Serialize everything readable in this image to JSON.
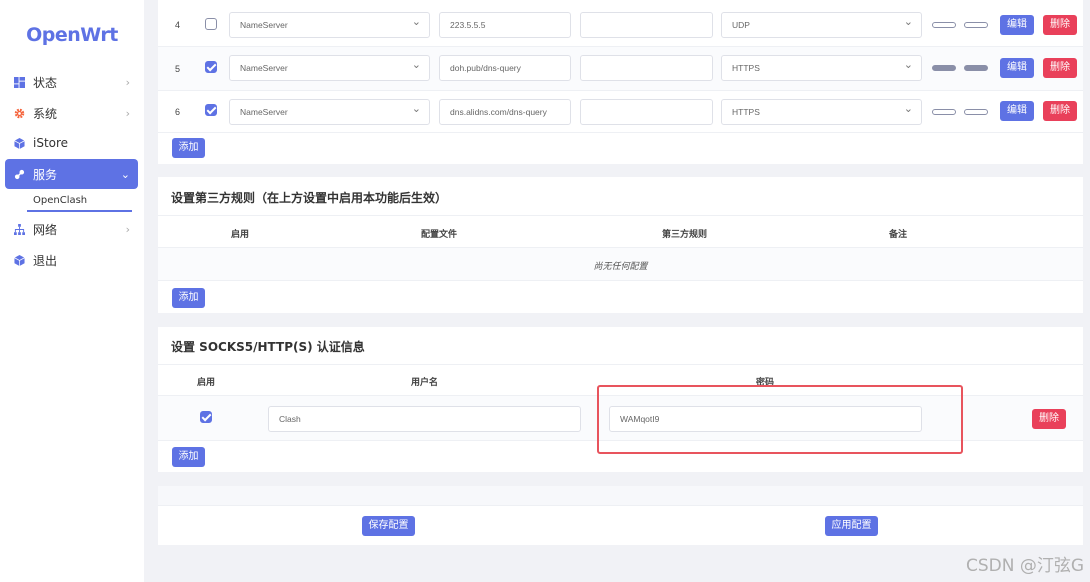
{
  "sidebar": {
    "logo": "OpenWrt",
    "items": [
      {
        "label": "状态",
        "icon": "dashboard-icon"
      },
      {
        "label": "系统",
        "icon": "gear-icon"
      },
      {
        "label": "iStore",
        "icon": "cube-icon"
      },
      {
        "label": "服务",
        "icon": "services-icon"
      },
      {
        "label": "网络",
        "icon": "network-icon"
      },
      {
        "label": "退出",
        "icon": "logout-icon"
      }
    ],
    "subitem": "OpenClash",
    "accent": "#5e72e4"
  },
  "dns_table": {
    "rows": [
      {
        "index": "4",
        "enabled": false,
        "type": "NameServer",
        "address": "223.5.5.5",
        "port": "",
        "protocol": "UDP",
        "edit": "编辑",
        "delete": "删除"
      },
      {
        "index": "5",
        "enabled": true,
        "type": "NameServer",
        "address": "doh.pub/dns-query",
        "port": "",
        "protocol": "HTTPS",
        "edit": "编辑",
        "delete": "删除"
      },
      {
        "index": "6",
        "enabled": true,
        "type": "NameServer",
        "address": "dns.alidns.com/dns-query",
        "port": "",
        "protocol": "HTTPS",
        "edit": "编辑",
        "delete": "删除"
      }
    ],
    "add_label": "添加"
  },
  "rules_section": {
    "title": "设置第三方规则（在上方设置中启用本功能后生效）",
    "headers": [
      "启用",
      "配置文件",
      "第三方规则",
      "备注"
    ],
    "empty_text": "尚无任何配置",
    "add_label": "添加"
  },
  "auth_section": {
    "title": "设置 SOCKS5/HTTP(S) 认证信息",
    "headers": [
      "启用",
      "用户名",
      "密码"
    ],
    "row": {
      "enabled": true,
      "username": "Clash",
      "password": "WAMqotI9",
      "delete": "删除"
    },
    "add_label": "添加"
  },
  "footer": {
    "save_label": "保存配置",
    "apply_label": "应用配置"
  },
  "watermark": "CSDN @汀弦G"
}
